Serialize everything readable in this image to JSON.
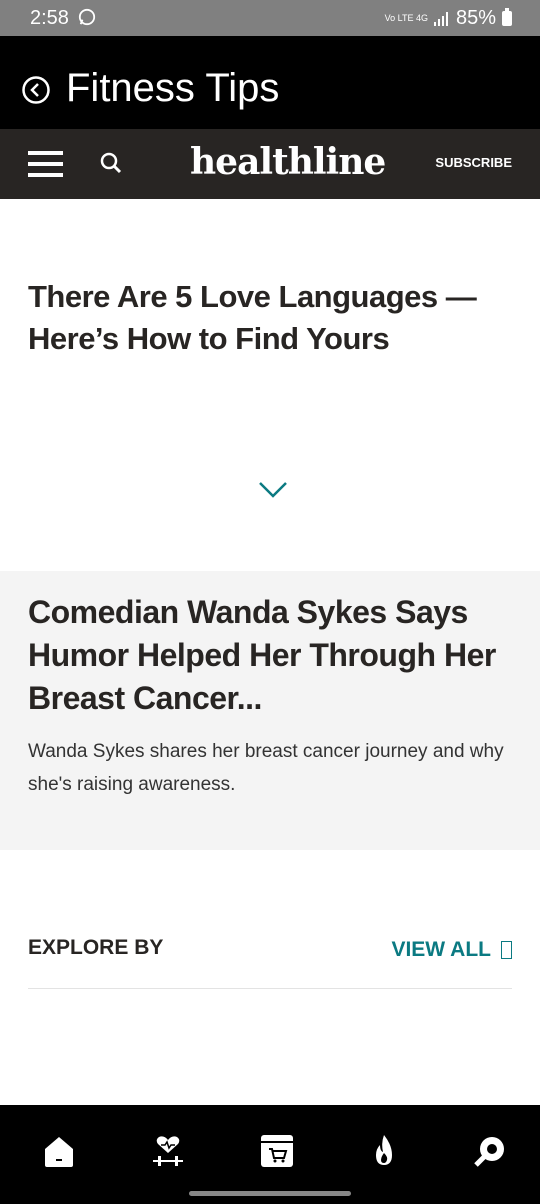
{
  "status": {
    "time": "2:58",
    "network": "Vo LTE 4G",
    "battery": "85%"
  },
  "appbar": {
    "title": "Fitness Tips",
    "back_icon": "back-circle-icon"
  },
  "healthline": {
    "logo": "healthline",
    "subscribe": "SUBSCRIBE",
    "menu_icon": "hamburger-menu-icon",
    "search_icon": "search-icon"
  },
  "article1": {
    "title": "There Are 5 Love Languages — Here’s How to Find Yours"
  },
  "article2": {
    "title": "Comedian Wanda Sykes Says Humor Helped Her Through Her Breast Cancer...",
    "summary": "Wanda Sykes shares her breast cancer journey and why she's raising awareness."
  },
  "explore": {
    "label": "EXPLORE BY",
    "view_all": "VIEW ALL"
  },
  "colors": {
    "accent": "#0b7a82",
    "header": "#282523",
    "appbar": "#000000"
  },
  "bottom_nav": [
    "home-icon",
    "fitness-heart-dumbbell-icon",
    "shop-icon",
    "fire-icon",
    "settings-wrench-icon"
  ]
}
